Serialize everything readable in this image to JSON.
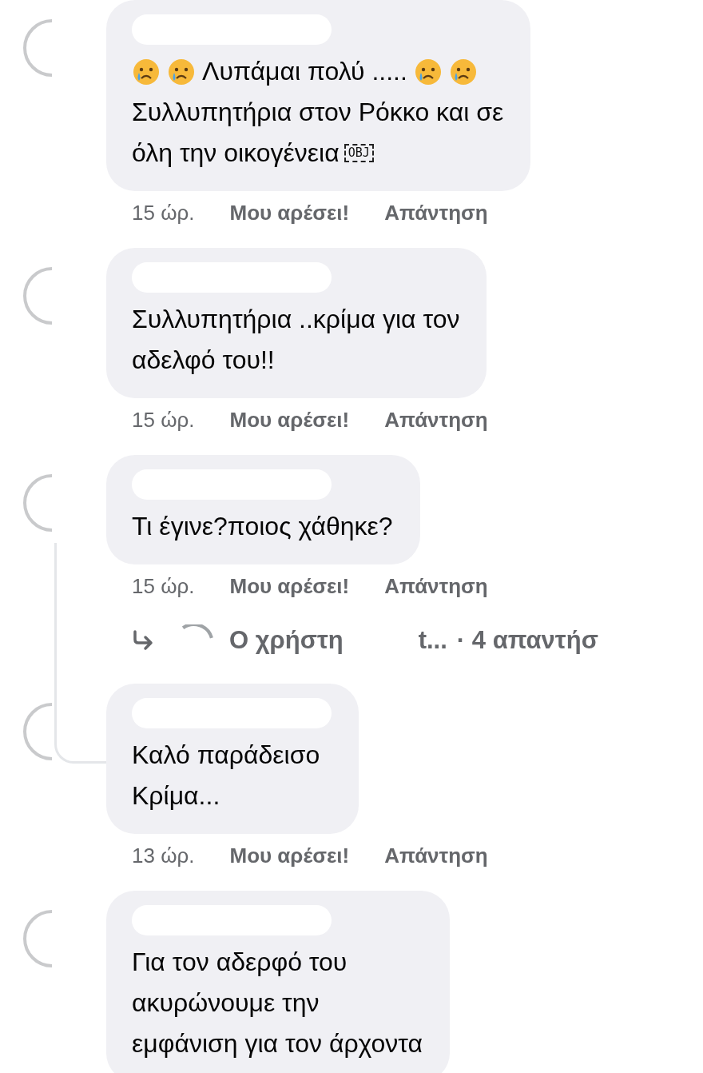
{
  "comments": [
    {
      "lines": [
        [
          {
            "kind": "emoji"
          },
          {
            "kind": "emoji"
          },
          {
            "kind": "text",
            "text": "Λυπάμαι πολύ ....."
          },
          {
            "kind": "emoji"
          },
          {
            "kind": "emoji"
          }
        ],
        [
          {
            "kind": "text",
            "text": "Συλλυπητήρια στον Ρόκκο και σε"
          }
        ],
        [
          {
            "kind": "text",
            "text": "όλη την οικογένεια"
          },
          {
            "kind": "object",
            "text": "OBJ"
          }
        ]
      ],
      "time": "15 ώρ.",
      "like": "Μου αρέσει!",
      "reply": "Απάντηση",
      "nested": false
    },
    {
      "lines": [
        [
          {
            "kind": "text",
            "text": "Συλλυπητήρια ..κρίμα για τον"
          }
        ],
        [
          {
            "kind": "text",
            "text": "αδελφό του!!"
          }
        ]
      ],
      "time": "15 ώρ.",
      "like": "Μου αρέσει!",
      "reply": "Απάντηση",
      "nested": false
    },
    {
      "lines": [
        [
          {
            "kind": "text",
            "text": "Τι έγινε?ποιος χάθηκε?"
          }
        ]
      ],
      "time": "15 ώρ.",
      "like": "Μου αρέσει!",
      "reply": "Απάντηση",
      "nested": true,
      "replies_link": {
        "prefix": "Ο χρήστη",
        "suffix": "t...",
        "count": "· 4 απαντήσ"
      }
    },
    {
      "lines": [
        [
          {
            "kind": "text",
            "text": "Καλό παράδεισο"
          }
        ],
        [
          {
            "kind": "text",
            "text": "Κρίμα..."
          }
        ]
      ],
      "time": "13 ώρ.",
      "like": "Μου αρέσει!",
      "reply": "Απάντηση",
      "nested": false
    },
    {
      "lines": [
        [
          {
            "kind": "text",
            "text": "Για τον αδερφό του"
          }
        ],
        [
          {
            "kind": "text",
            "text": "ακυρώνουμε την"
          }
        ],
        [
          {
            "kind": "text",
            "text": "εμφάνιση για τον άρχοντα"
          }
        ]
      ],
      "nested": false
    }
  ]
}
